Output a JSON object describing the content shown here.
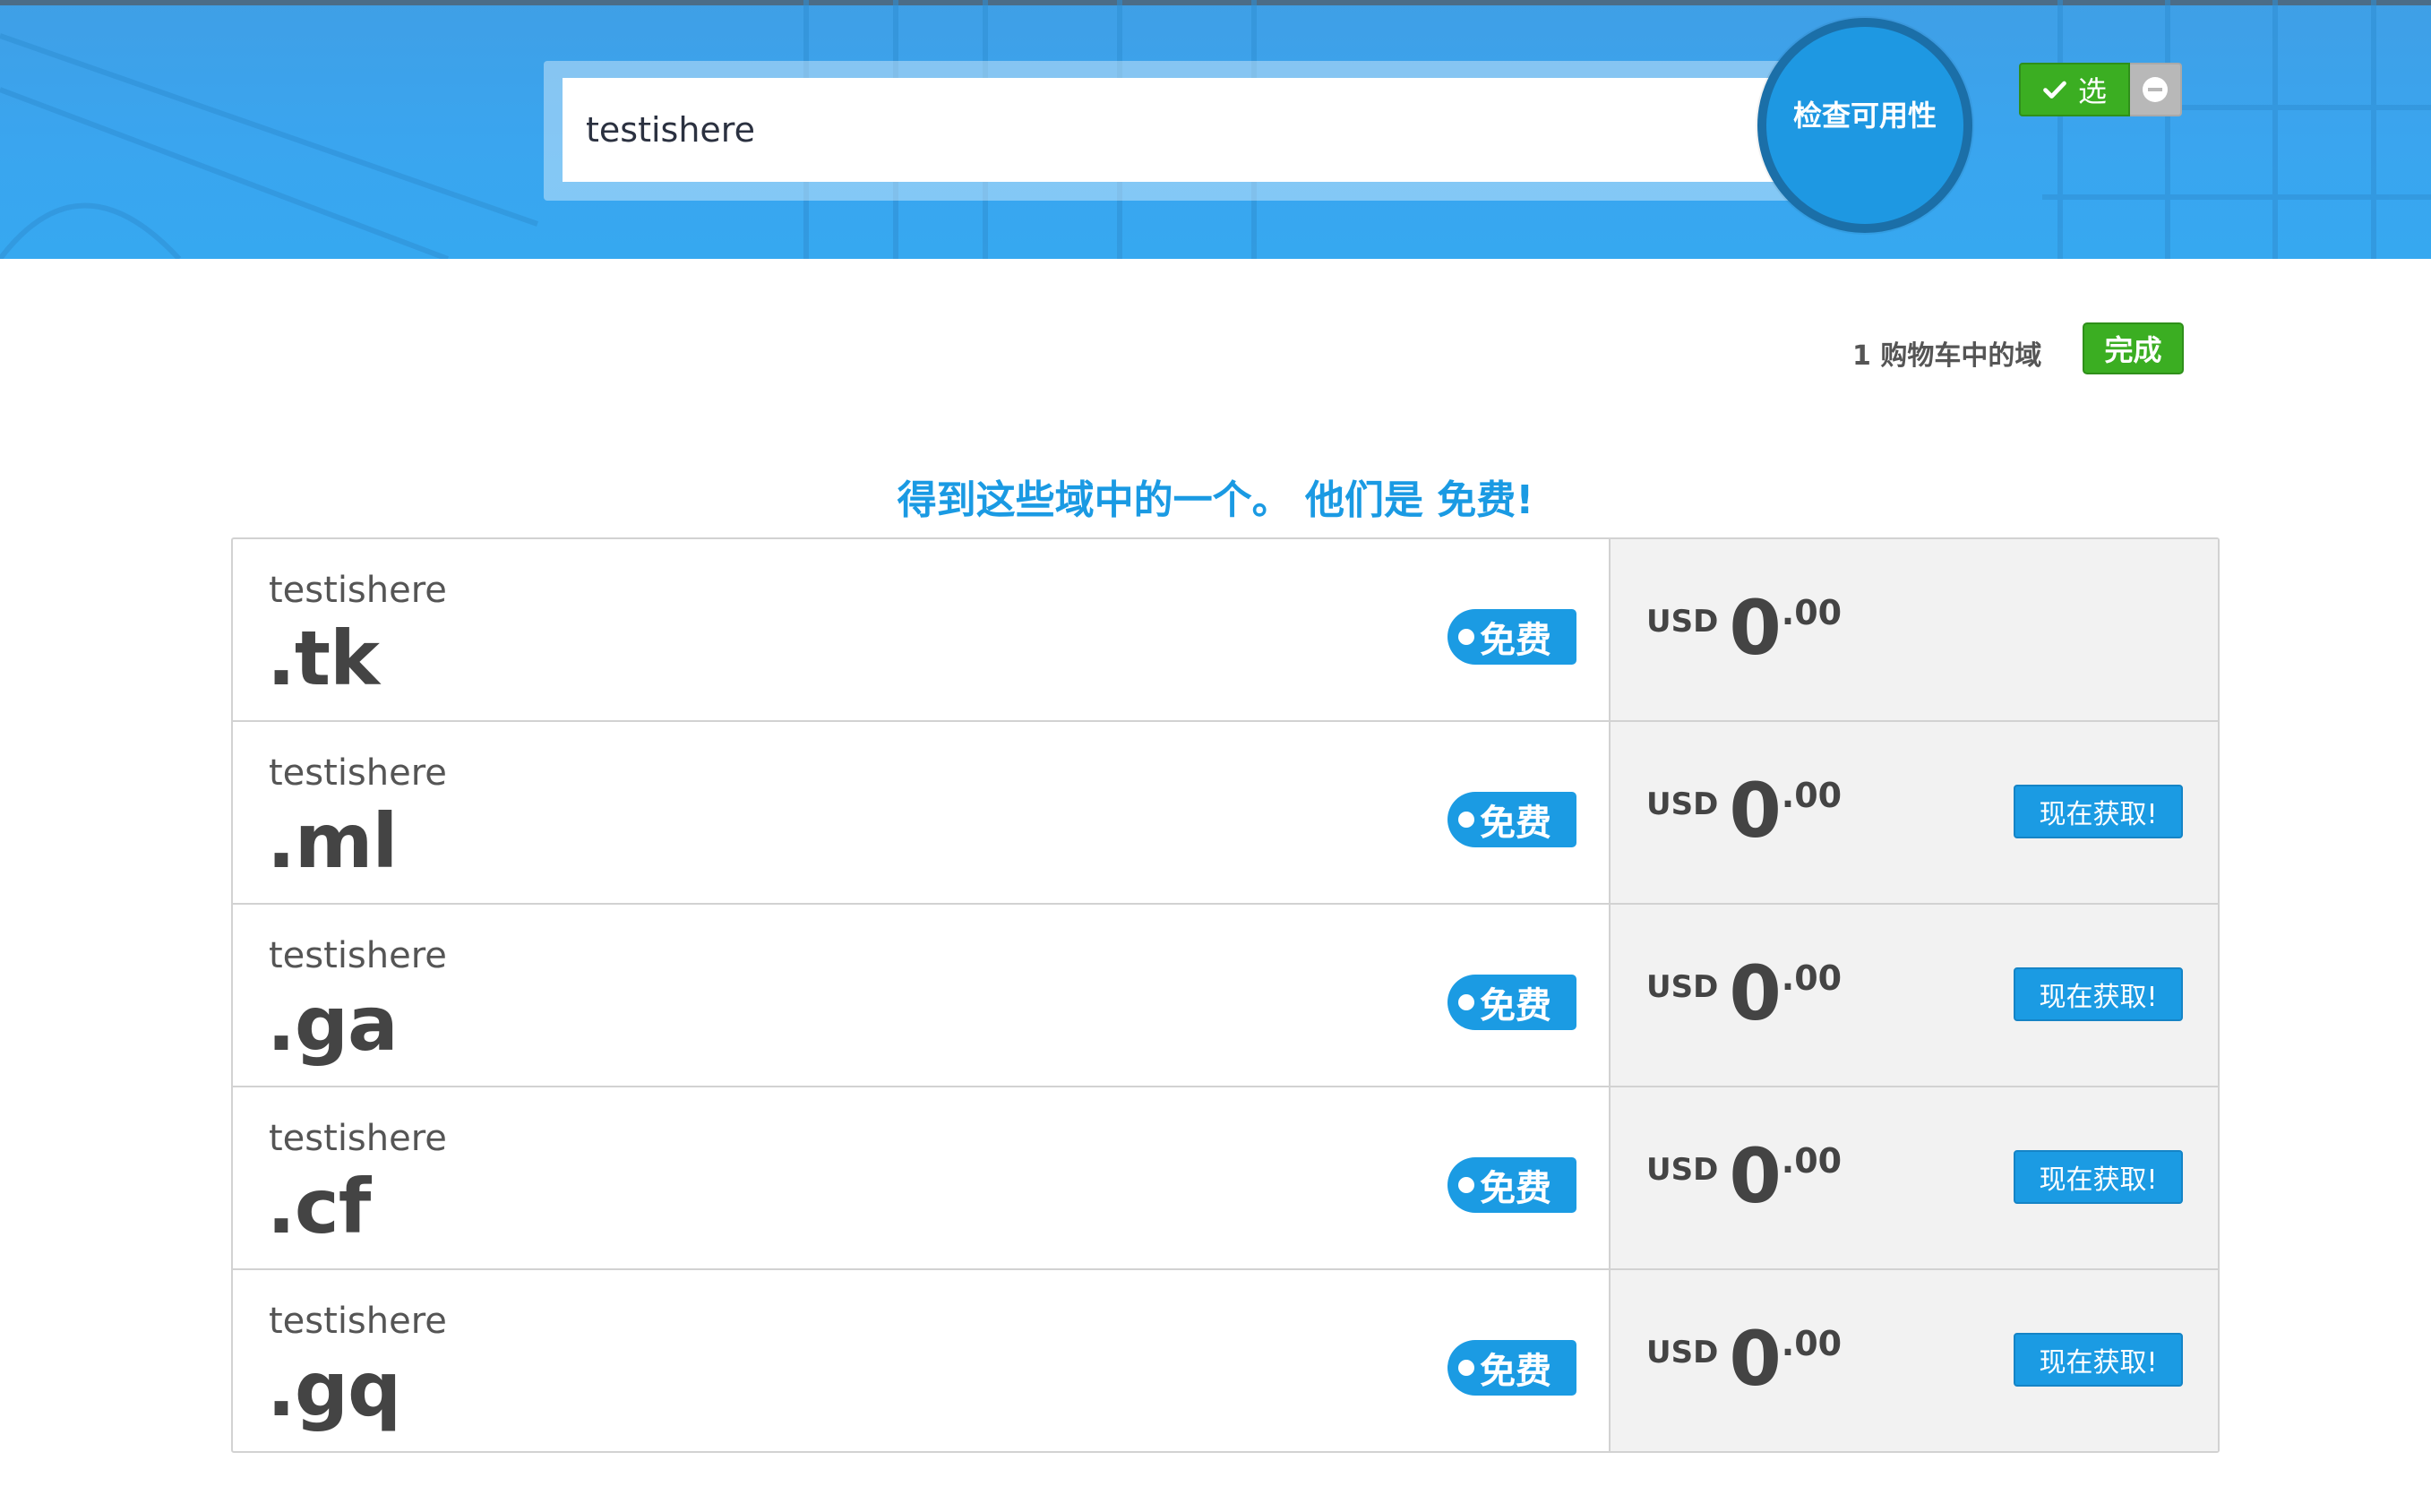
{
  "search": {
    "value": "testishere",
    "button_label": "检查可用性"
  },
  "cart": {
    "status": "1 购物车中的域",
    "done_label": "完成"
  },
  "headline": "得到这些域中的一个。 他们是 免费!",
  "domains": [
    {
      "sld": "testishere",
      "tld": ".tk",
      "badge": "免费",
      "currency": "USD",
      "price_int": "0",
      "price_dec": ".00",
      "selected": true,
      "select_label": "选"
    },
    {
      "sld": "testishere",
      "tld": ".ml",
      "badge": "免费",
      "currency": "USD",
      "price_int": "0",
      "price_dec": ".00",
      "selected": false,
      "action_label": "现在获取!"
    },
    {
      "sld": "testishere",
      "tld": ".ga",
      "badge": "免费",
      "currency": "USD",
      "price_int": "0",
      "price_dec": ".00",
      "selected": false,
      "action_label": "现在获取!"
    },
    {
      "sld": "testishere",
      "tld": ".cf",
      "badge": "免费",
      "currency": "USD",
      "price_int": "0",
      "price_dec": ".00",
      "selected": false,
      "action_label": "现在获取!"
    },
    {
      "sld": "testishere",
      "tld": ".gq",
      "badge": "免费",
      "currency": "USD",
      "price_int": "0",
      "price_dec": ".00",
      "selected": false,
      "action_label": "现在获取!"
    }
  ],
  "icons": {
    "selected": "check-icon",
    "remove": "minus-circle-icon",
    "badge": "tag-dot-icon"
  },
  "colors": {
    "accent": "#1b9be3",
    "success": "#3bae22",
    "hero": "#3aa5ef"
  }
}
